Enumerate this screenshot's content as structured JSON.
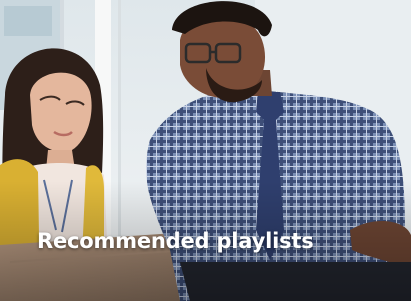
{
  "tile": {
    "title": "Recommended playlists",
    "image_subject": "two-colleagues-looking-at-laptop"
  },
  "colors": {
    "title_text": "#ffffff",
    "shirt_plaid": "#4b5f86",
    "cardigan": "#e0b93a",
    "background_window": "#e6ecef"
  }
}
